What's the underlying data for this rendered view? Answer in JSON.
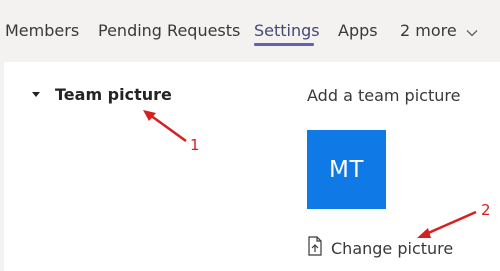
{
  "tabs": [
    {
      "label": "Members"
    },
    {
      "label": "Pending Requests"
    },
    {
      "label": "Settings",
      "active": true
    },
    {
      "label": "Apps"
    },
    {
      "label": "2 more"
    }
  ],
  "section": {
    "title": "Team picture",
    "expanded": true
  },
  "team_picture": {
    "add_label": "Add a team picture",
    "avatar_initials": "MT",
    "avatar_color": "#0f7ae5",
    "change_label": "Change picture"
  },
  "annotations": {
    "arrow_color": "#d61f1f",
    "labels": [
      "1",
      "2"
    ]
  },
  "colors": {
    "accent": "#6264a7",
    "background": "#f3f2f1",
    "panel": "#ffffff"
  }
}
